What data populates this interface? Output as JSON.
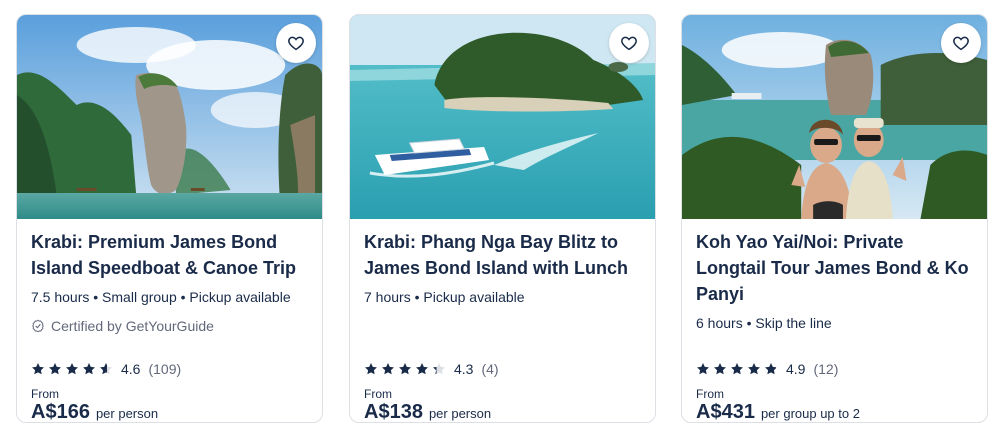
{
  "cards": [
    {
      "title": "Krabi: Premium James Bond Island Speedboat & Canoe Trip",
      "meta": "7.5 hours • Small group • Pickup available",
      "certified": "Certified by GetYourGuide",
      "rating": "4.6",
      "rating_value": 4.6,
      "reviews": "(109)",
      "from": "From",
      "price": "A$166",
      "per": "per person"
    },
    {
      "title": "Krabi: Phang Nga Bay Blitz to James Bond Island with Lunch",
      "meta": "7 hours • Pickup available",
      "certified": "",
      "rating": "4.3",
      "rating_value": 4.3,
      "reviews": "(4)",
      "from": "From",
      "price": "A$138",
      "per": "per person"
    },
    {
      "title": "Koh Yao Yai/Noi: Private Longtail Tour James Bond & Ko Panyi",
      "meta": "6 hours • Skip the line",
      "certified": "",
      "rating": "4.9",
      "rating_value": 4.9,
      "reviews": "(12)",
      "from": "From",
      "price": "A$431",
      "per": "per group up to 2"
    }
  ],
  "icons": {
    "wishlist": "heart-outline-icon",
    "star": "star-icon",
    "certified": "check-badge-icon"
  },
  "colors": {
    "text": "#1a2b49",
    "muted": "#63687a",
    "star": "#1a2b49",
    "star_empty": "#dcdfe4"
  }
}
